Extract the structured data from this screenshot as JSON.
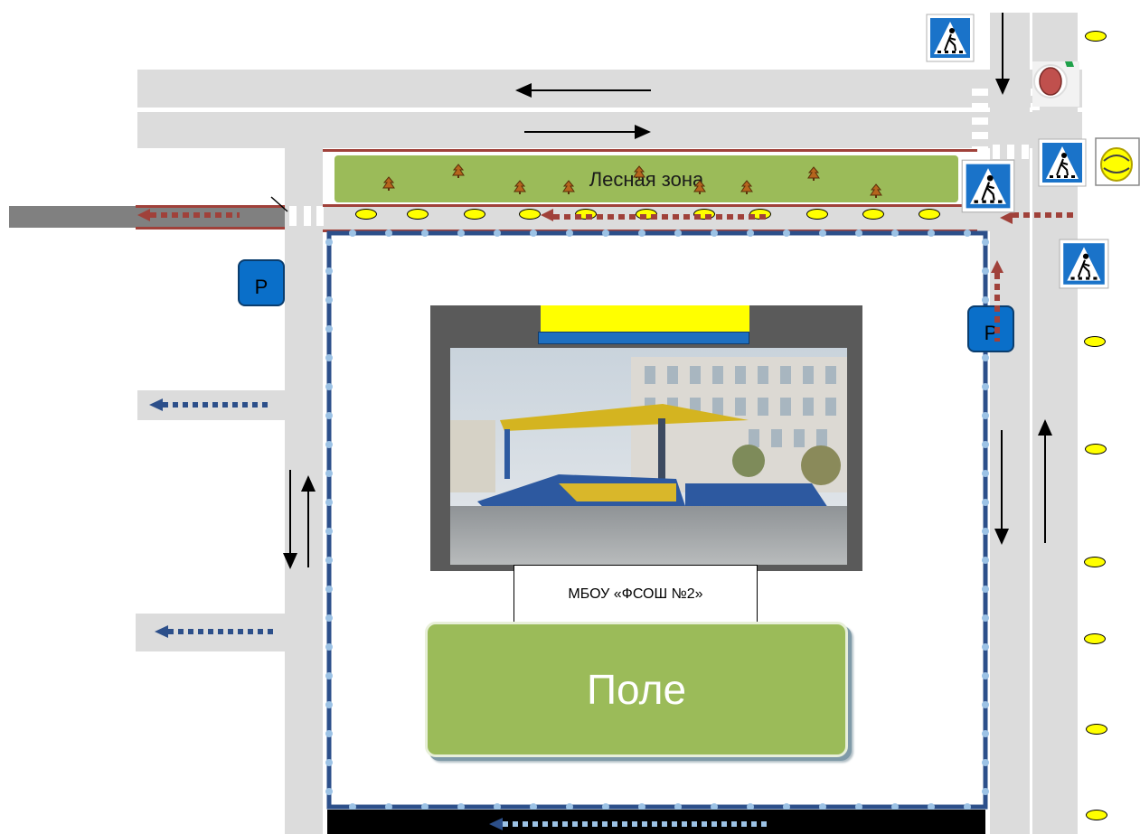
{
  "labels": {
    "forest_zone": "Лесная зона",
    "school": "МБОУ «ФСОШ №2»",
    "field": "Поле",
    "parking_left": "P",
    "parking_right": "P"
  },
  "icons": {
    "crosswalk": "pedestrian-crossing-sign-icon",
    "no_entry": "no-entry-sign-icon",
    "traffic_light": "traffic-light-icon",
    "lamp": "street-lamp-icon",
    "tree": "tree-icon",
    "parking": "parking-sign-icon"
  },
  "colors": {
    "road": "#dcdcdc",
    "forest": "#9bbb59",
    "school_route": "#2c4f8a",
    "danger_route": "#a0413a",
    "sign_blue": "#0a6fc9",
    "lamp_yellow": "#ffff00"
  }
}
